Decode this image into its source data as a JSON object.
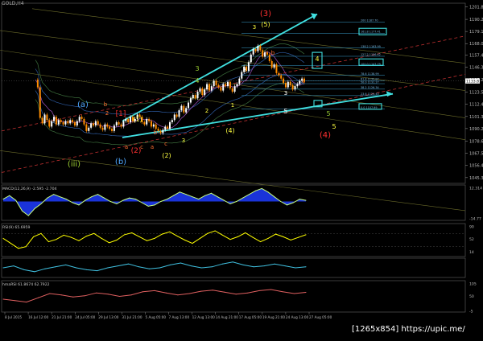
{
  "chart_data": [
    {
      "type": "line",
      "pane": "price",
      "title": "GOLD,H4",
      "ylim": [
        1040,
        1205
      ],
      "y_ticks": [
        1201.8,
        1190.2,
        1179.1,
        1168.0,
        1157.4,
        1146.3,
        1135.2,
        1123.5,
        1112.4,
        1101.3,
        1090.2,
        1078.6,
        1067.5,
        1056.4,
        1045.3
      ],
      "current_price": "1133.81",
      "price_series_note": "candlesticks, approximated as close values",
      "closes": [
        1135,
        1128,
        1100,
        1095,
        1103,
        1098,
        1092,
        1097,
        1101,
        1094,
        1098,
        1096,
        1094,
        1097,
        1095,
        1098,
        1096,
        1093,
        1097,
        1101,
        1099,
        1094,
        1088,
        1091,
        1095,
        1093,
        1097,
        1094,
        1091,
        1089,
        1094,
        1092,
        1090,
        1088,
        1093,
        1096,
        1094,
        1092,
        1097,
        1099,
        1096,
        1101,
        1097,
        1099,
        1103,
        1101,
        1096,
        1094,
        1099,
        1097,
        1092,
        1094,
        1090,
        1088,
        1086,
        1089,
        1092,
        1090,
        1096,
        1098,
        1103,
        1101,
        1107,
        1111,
        1105,
        1109,
        1114,
        1118,
        1121,
        1118,
        1124,
        1127,
        1121,
        1126,
        1131,
        1125,
        1129,
        1134,
        1130,
        1128,
        1125,
        1131,
        1129,
        1133,
        1127,
        1124,
        1129,
        1131,
        1136,
        1142,
        1147,
        1143,
        1151,
        1158,
        1163,
        1161,
        1166,
        1162,
        1156,
        1160,
        1158,
        1152,
        1146,
        1149,
        1141,
        1139,
        1136,
        1132,
        1128,
        1133,
        1130,
        1126,
        1129,
        1131,
        1134,
        1136,
        1133
      ],
      "fib_levels": [
        {
          "label": "200 1187.70",
          "value": 1187.7
        },
        {
          "label": "161.8 1177.41",
          "value": 1177.4
        },
        {
          "label": "138.2 1163.99",
          "value": 1164.0
        },
        {
          "label": "127.2 1156.42",
          "value": 1156.4
        },
        {
          "label": "100.0 1147.79",
          "value": 1147.8
        },
        {
          "label": "78.6 1138.99",
          "value": 1139.0
        },
        {
          "label": "61.8 1133.87",
          "value": 1133.9
        },
        {
          "label": "50.0 1131.27",
          "value": 1131.3
        },
        {
          "label": "38.2 1126.34",
          "value": 1126.3
        },
        {
          "label": "23.6 1120.40",
          "value": 1120.4
        },
        {
          "label": "0.0 1107.99",
          "value": 1108.0
        }
      ],
      "wave_labels": [
        {
          "text": "(iii)",
          "color": "#9acd32"
        },
        {
          "text": "(a)",
          "color": "#4fa8ff"
        },
        {
          "text": "(b)",
          "color": "#4fa8ff"
        },
        {
          "text": "[1]",
          "color": "#ff3030"
        },
        {
          "text": "(2)",
          "color": "#ff3030"
        },
        {
          "text": "(1)",
          "color": "#ffff40"
        },
        {
          "text": "(2)",
          "color": "#ffff40"
        },
        {
          "text": "(3)",
          "color": "#ff3030"
        },
        {
          "text": "(4)",
          "color": "#ff3030"
        },
        {
          "text": "(5)",
          "color": "#ffff40"
        },
        {
          "text": "(4)",
          "color": "#ffff40"
        },
        {
          "text": "3",
          "color": "#ffff40"
        },
        {
          "text": "4",
          "color": "#ffff40"
        },
        {
          "text": "5",
          "color": "#ffff40"
        },
        {
          "text": "4",
          "color": "#9acd32"
        },
        {
          "text": "3",
          "color": "#9acd32"
        },
        {
          "text": "5",
          "color": "#9acd32"
        },
        {
          "text": "b",
          "color": "#ff7030"
        },
        {
          "text": "a",
          "color": "#ff7030"
        },
        {
          "text": "c",
          "color": "#ff7030"
        },
        {
          "text": "2",
          "color": "#ff7030"
        },
        {
          "text": "a",
          "color": "#ff7030"
        },
        {
          "text": "c",
          "color": "#ff7030"
        },
        {
          "text": "b",
          "color": "#ff7030"
        },
        {
          "text": "3",
          "color": "#ffff40"
        },
        {
          "text": "2",
          "color": "#ffff40"
        },
        {
          "text": "1",
          "color": "#ffff40"
        },
        {
          "text": "3",
          "color": "#ffffff"
        },
        {
          "text": "5",
          "color": "#ffffff"
        },
        {
          "text": "3",
          "color": "#ffffff"
        },
        {
          "text": "b",
          "color": "#ff7030"
        },
        {
          "text": "c",
          "color": "#ff7030"
        }
      ]
    },
    {
      "type": "line",
      "pane": "macd",
      "title": "MACD(12,26,9) -2.595 -2.704",
      "y_ticks": [
        12.314,
        -14.77
      ],
      "values": [
        2,
        5,
        1,
        -8,
        -12,
        -6,
        -2,
        3,
        6,
        4,
        2,
        -1,
        -3,
        1,
        4,
        6,
        3,
        0,
        -2,
        1,
        3,
        2,
        -1,
        -4,
        -3,
        0,
        2,
        5,
        8,
        6,
        4,
        2,
        5,
        7,
        4,
        1,
        -2,
        0,
        3,
        6,
        9,
        11,
        8,
        4,
        0,
        -3,
        -1,
        2,
        1
      ]
    },
    {
      "type": "line",
      "pane": "rsi",
      "title": "RSI(9) 65.6959",
      "y_ticks": [
        90,
        52,
        14
      ],
      "values": [
        55,
        40,
        25,
        30,
        60,
        70,
        45,
        52,
        65,
        58,
        48,
        62,
        70,
        55,
        42,
        50,
        66,
        72,
        60,
        48,
        55,
        68,
        75,
        62,
        50,
        40,
        55,
        70,
        78,
        65,
        52,
        60,
        72,
        58,
        45,
        55,
        68,
        60,
        50,
        58,
        66
      ]
    },
    {
      "type": "line",
      "pane": "adx",
      "title": "",
      "y_ticks": [],
      "values": [
        20,
        22,
        18,
        16,
        19,
        21,
        23,
        20,
        18,
        17,
        20,
        22,
        24,
        21,
        19,
        20,
        23,
        25,
        22,
        20,
        21,
        24,
        26,
        23,
        21,
        22,
        24,
        22,
        20,
        21
      ]
    },
    {
      "type": "line",
      "pane": "stoch",
      "title": "hmaRSI 61.8674 62.7922",
      "y_ticks": [
        105,
        50,
        -5
      ],
      "values": [
        40,
        35,
        30,
        45,
        60,
        55,
        48,
        52,
        62,
        58,
        50,
        55,
        66,
        70,
        62,
        55,
        60,
        68,
        72,
        65,
        58,
        62,
        70,
        74,
        66,
        60,
        64
      ]
    }
  ],
  "x_axis": {
    "labels": [
      "8 Jul 2015",
      "16 Jul 12:00",
      "21 Jul 21:00",
      "24 Jul 05:00",
      "29 Jul 13:00",
      "31 Jul 21:00",
      "5 Aug 05:00",
      "7 Aug 13:00",
      "12 Aug 13:00",
      "14 Aug 21:00",
      "17 Aug 05:00",
      "19 Aug 21:00",
      "24 Aug 13:00",
      "27 Aug 05:00"
    ]
  },
  "colors": {
    "background": "#000000",
    "bull_candle": "#ffffff",
    "bear_candle": "#ff8c00",
    "channel": "#40e0e0",
    "fib": "#3aa0d0",
    "macd_fill": "#1e3cff",
    "rsi_line": "#ffff00",
    "rsi_signal": "#ff40ff"
  },
  "watermark": "[1265x854] https://upic.me/"
}
